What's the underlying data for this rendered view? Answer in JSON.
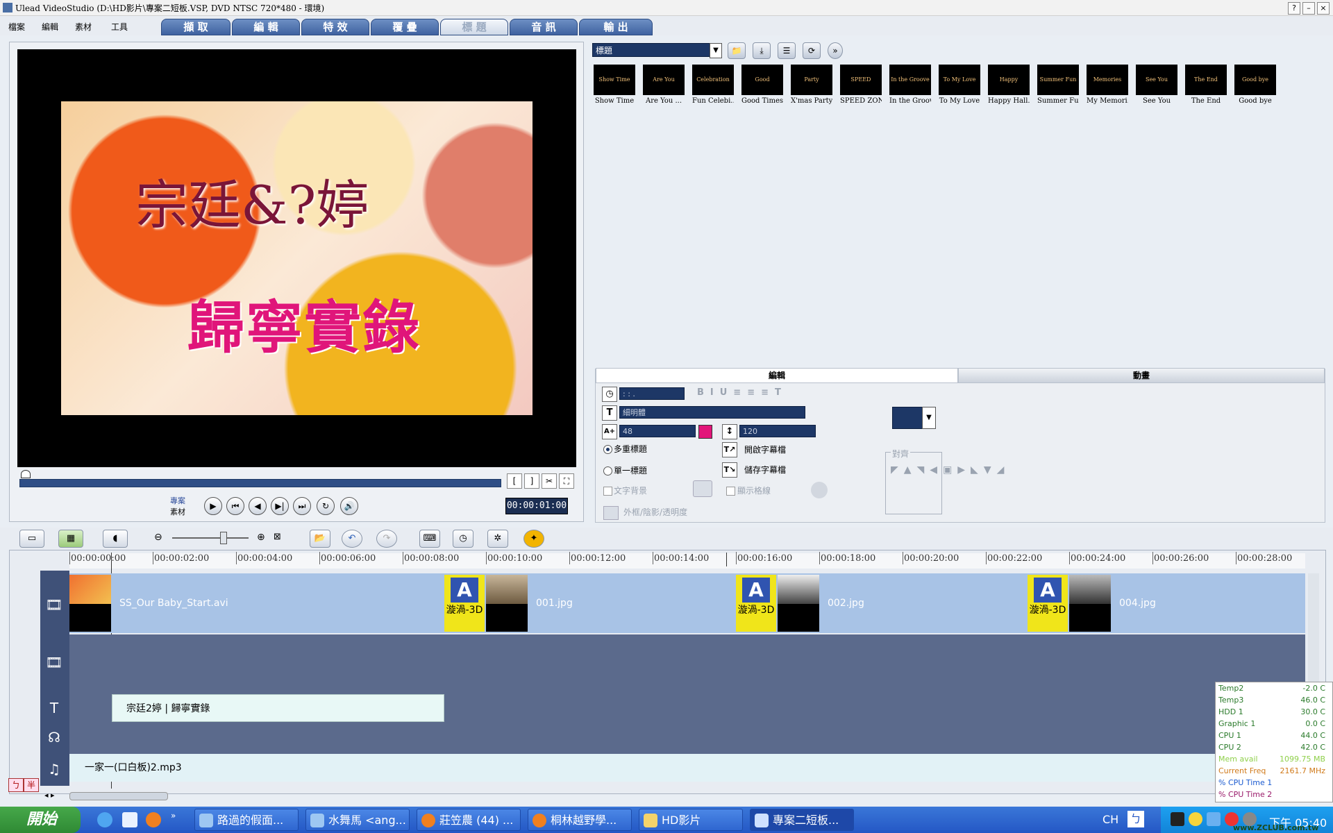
{
  "window": {
    "title": "Ulead VideoStudio (D:\\HD影片\\專案二短板.VSP, DVD NTSC 720*480 - 環境)",
    "buttons": [
      "?",
      "–",
      "×"
    ]
  },
  "menu": [
    "檔案",
    "編輯",
    "素材",
    "工具"
  ],
  "steps": [
    "擷 取",
    "編 輯",
    "特 效",
    "覆 疊",
    "標 題",
    "音 訊",
    "輸 出"
  ],
  "active_step": "標 題",
  "preview": {
    "title_line1": "宗廷&?婷",
    "title_line2": "歸寧實錄",
    "mode_project": "專案",
    "mode_clip": "素材",
    "timecode": "00:00:01:00",
    "controls": [
      "▶",
      "⏮",
      "◀",
      "▶|",
      "⏭",
      "↻",
      "🔊"
    ]
  },
  "library": {
    "category": "標題",
    "thumbnails": [
      {
        "caption": "Show Time",
        "art": "Show Time"
      },
      {
        "caption": "Are You ...",
        "art": "Are You Ready?"
      },
      {
        "caption": "Fun Celebi...",
        "art": "Celebration"
      },
      {
        "caption": "Good Times",
        "art": "Good"
      },
      {
        "caption": "X'mas Party",
        "art": "Party"
      },
      {
        "caption": "SPEED ZONE",
        "art": "SPEED"
      },
      {
        "caption": "In the Groove",
        "art": "In the Groove"
      },
      {
        "caption": "To My Love",
        "art": "To My Love"
      },
      {
        "caption": "Happy Hall...",
        "art": "Happy Halloween"
      },
      {
        "caption": "Summer Fun",
        "art": "Summer Fun"
      },
      {
        "caption": "My Memori...",
        "art": "Memories"
      },
      {
        "caption": "See You",
        "art": "See You"
      },
      {
        "caption": "The End",
        "art": "The End"
      },
      {
        "caption": "Good bye",
        "art": "Good bye"
      }
    ]
  },
  "options": {
    "tab_edit": "編輯",
    "tab_anim": "動畫",
    "duration": " :  :  . ",
    "font": "細明體",
    "size": "48",
    "line_spacing": "120",
    "multi_title": "多重標題",
    "single_title": "單一標題",
    "open_subtitle": "開啟字幕檔",
    "save_subtitle": "儲存字幕檔",
    "text_bg": "文字背景",
    "show_grid": "顯示格線",
    "border_shadow": "外框/陰影/透明度",
    "align": "對齊",
    "font_color": "#e2157a"
  },
  "timeline": {
    "ruler": [
      "00:00:00:00",
      "00:00:02:00",
      "00:00:04:00",
      "00:00:06:00",
      "00:00:08:00",
      "00:00:10:00",
      "00:00:12:00",
      "00:00:14:00",
      "00:00:16:00",
      "00:00:18:00",
      "00:00:20:00",
      "00:00:22:00",
      "00:00:24:00",
      "00:00:26:00",
      "00:00:28:00"
    ],
    "video_clips": [
      "SS_Our Baby_Start.avi",
      "001.jpg",
      "002.jpg",
      "004.jpg"
    ],
    "transition_label": "漩渦-3D",
    "title_clip": "宗廷2婷 | 歸寧實錄",
    "music_clip": "一家一(口白板)2.mp3"
  },
  "hwmon": [
    {
      "name": "Temp2",
      "value": "-2.0 C",
      "color": "#2a7a2a"
    },
    {
      "name": "Temp3",
      "value": "46.0 C",
      "color": "#2a7a2a"
    },
    {
      "name": "HDD 1",
      "value": "30.0 C",
      "color": "#2a7a2a"
    },
    {
      "name": "Graphic 1",
      "value": "0.0 C",
      "color": "#2a7a2a"
    },
    {
      "name": "CPU 1",
      "value": "44.0 C",
      "color": "#2a7a2a"
    },
    {
      "name": "CPU 2",
      "value": "42.0 C",
      "color": "#2a7a2a"
    },
    {
      "name": "Mem avail",
      "value": "1099.75 MB",
      "color": "#8fd04a"
    },
    {
      "name": "Current Freq",
      "value": "2161.7 MHz",
      "color": "#d07a1a"
    },
    {
      "name": "% CPU Time 1",
      "value": "",
      "color": "#1a5ad0"
    },
    {
      "name": "% CPU Time 2",
      "value": "",
      "color": "#9a1a6a"
    }
  ],
  "ime": [
    "ㄅ",
    "半"
  ],
  "taskbar": {
    "start": "開始",
    "tasks": [
      "路過的假面...",
      "水舞馬 <ang...",
      "莊笠農 (44) ...",
      "桐林越野學...",
      "HD影片",
      "專案二短板..."
    ],
    "lang": "CH",
    "clock": "下午 05:40",
    "watermark": "www.ZCLUB.com.tw"
  }
}
